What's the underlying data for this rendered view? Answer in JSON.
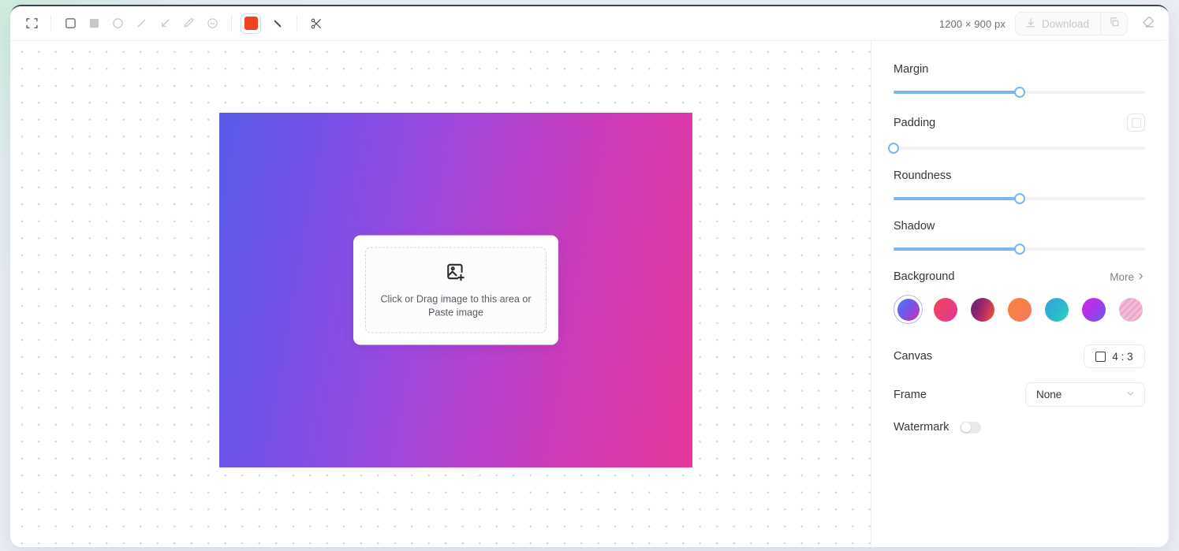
{
  "toolbar": {
    "tools": [
      {
        "name": "crop-tool",
        "icon": "crop-frame-icon"
      },
      {
        "name": "rectangle-tool",
        "icon": "square-outline-icon"
      },
      {
        "name": "filled-rectangle-tool",
        "icon": "square-filled-icon"
      },
      {
        "name": "ellipse-tool",
        "icon": "circle-outline-icon"
      },
      {
        "name": "line-tool",
        "icon": "line-icon"
      },
      {
        "name": "arrow-tool",
        "icon": "arrow-icon"
      },
      {
        "name": "pencil-tool",
        "icon": "pencil-icon"
      },
      {
        "name": "emoji-tool",
        "icon": "emoji-icon"
      }
    ],
    "color_swatch": "#ee4422",
    "stroke_icon": "brush-icon",
    "cut_icon": "scissors-icon",
    "dimensions": "1200 × 900 px",
    "download_label": "Download",
    "download_icon": "download-icon",
    "copy_icon": "copy-icon",
    "eraser_icon": "eraser-icon"
  },
  "canvas": {
    "gradient_from": "#5b5cea",
    "gradient_to": "#e5389c",
    "dropzone": {
      "icon": "image-plus-icon",
      "line1": "Click or Drag image to this area",
      "line2": "or Paste image"
    }
  },
  "panel": {
    "sliders": [
      {
        "label": "Margin",
        "value": 50
      },
      {
        "label": "Padding",
        "value": 0
      },
      {
        "label": "Roundness",
        "value": 50
      },
      {
        "label": "Shadow",
        "value": 50
      }
    ],
    "padding_button_icon": "square-outline-icon",
    "background": {
      "label": "Background",
      "more_label": "More",
      "more_icon": "chevron-right-icon",
      "selected_index": 0,
      "swatches": [
        {
          "name": "blue-violet-magenta",
          "css": "linear-gradient(125deg,#4f7bf0 0%,#6d5bea 40%,#a33fd0 75%,#c92fa6 100%)"
        },
        {
          "name": "red-pink-magenta",
          "css": "linear-gradient(125deg,#f0445c 0%,#ec3f74 45%,#e0359f 100%)"
        },
        {
          "name": "purple-orange",
          "css": "linear-gradient(110deg,#5e2a78 0%,#8b2470 35%,#c5325c 65%,#e8622e 100%)"
        },
        {
          "name": "orange-salmon",
          "css": "linear-gradient(125deg,#f8813e 0%,#f7804c 50%,#f4726a 100%)"
        },
        {
          "name": "blue-teal",
          "css": "linear-gradient(125deg,#3a9ce0 0%,#2cb6cf 50%,#2ed5b8 100%)"
        },
        {
          "name": "magenta-violet",
          "css": "linear-gradient(125deg,#d226e8 0%,#a838ea 50%,#6e5cea 100%)"
        },
        {
          "name": "pink-texture",
          "css": "repeating-linear-gradient(135deg,#f3bcd6 0px,#f3bcd6 3px,#e9a8cb 3px,#e9a8cb 6px)"
        }
      ]
    },
    "canvas_row": {
      "label": "Canvas",
      "ratio": "4 : 3",
      "icon": "square-outline-icon"
    },
    "frame_row": {
      "label": "Frame",
      "value": "None",
      "icon": "chevron-down-icon"
    },
    "watermark_row": {
      "label": "Watermark",
      "enabled": false
    }
  }
}
